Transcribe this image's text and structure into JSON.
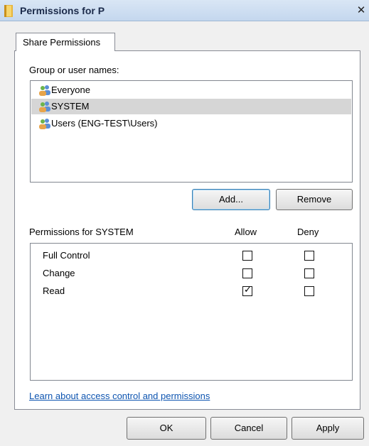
{
  "window": {
    "title": "Permissions for P",
    "close_glyph": "✕"
  },
  "tabs": [
    {
      "label": "Share Permissions",
      "active": true
    }
  ],
  "groups": {
    "label": "Group or user names:",
    "items": [
      {
        "name": "Everyone",
        "selected": false,
        "icon": "users-icon"
      },
      {
        "name": "SYSTEM",
        "selected": true,
        "icon": "users-icon"
      },
      {
        "name": "Users (ENG-TEST\\Users)",
        "selected": false,
        "icon": "users-icon"
      }
    ],
    "add_label": "Add...",
    "remove_label": "Remove"
  },
  "permissions": {
    "label": "Permissions for SYSTEM",
    "allow_header": "Allow",
    "deny_header": "Deny",
    "rows": [
      {
        "name": "Full Control",
        "allow": false,
        "deny": false
      },
      {
        "name": "Change",
        "allow": false,
        "deny": false
      },
      {
        "name": "Read",
        "allow": true,
        "deny": false
      }
    ]
  },
  "link_text": "Learn about access control and permissions",
  "footer": {
    "ok_label": "OK",
    "cancel_label": "Cancel",
    "apply_label": "Apply"
  },
  "colors": {
    "link": "#0d54b0",
    "selection": "#d6d6d6",
    "titlebar": "#c4d7ee"
  }
}
